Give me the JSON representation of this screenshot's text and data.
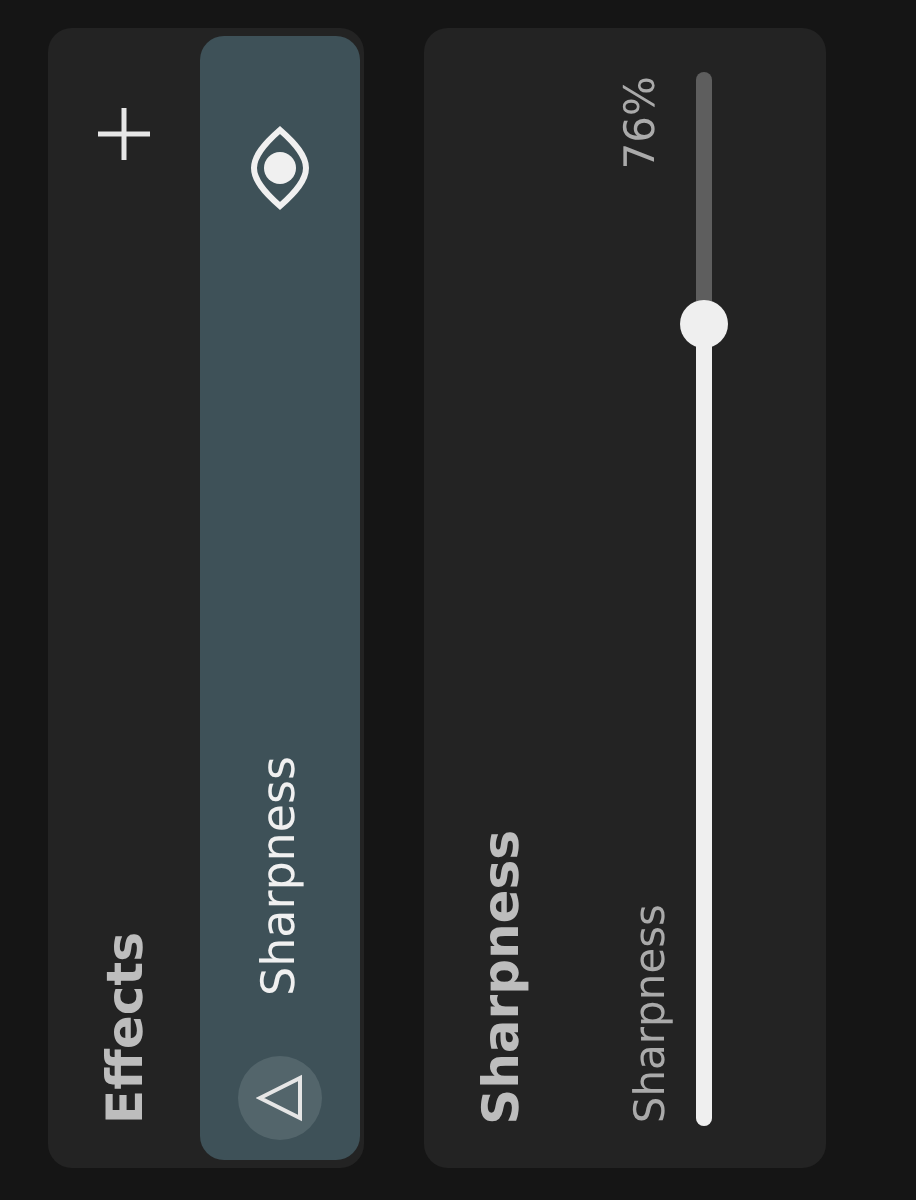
{
  "effects_panel": {
    "title": "Effects",
    "items": [
      {
        "name": "Sharpness",
        "selected": true,
        "visible": true
      }
    ]
  },
  "detail_panel": {
    "title": "Sharpness",
    "control": {
      "label": "Sharpness",
      "reading": "76%",
      "level": 0.76
    }
  }
}
